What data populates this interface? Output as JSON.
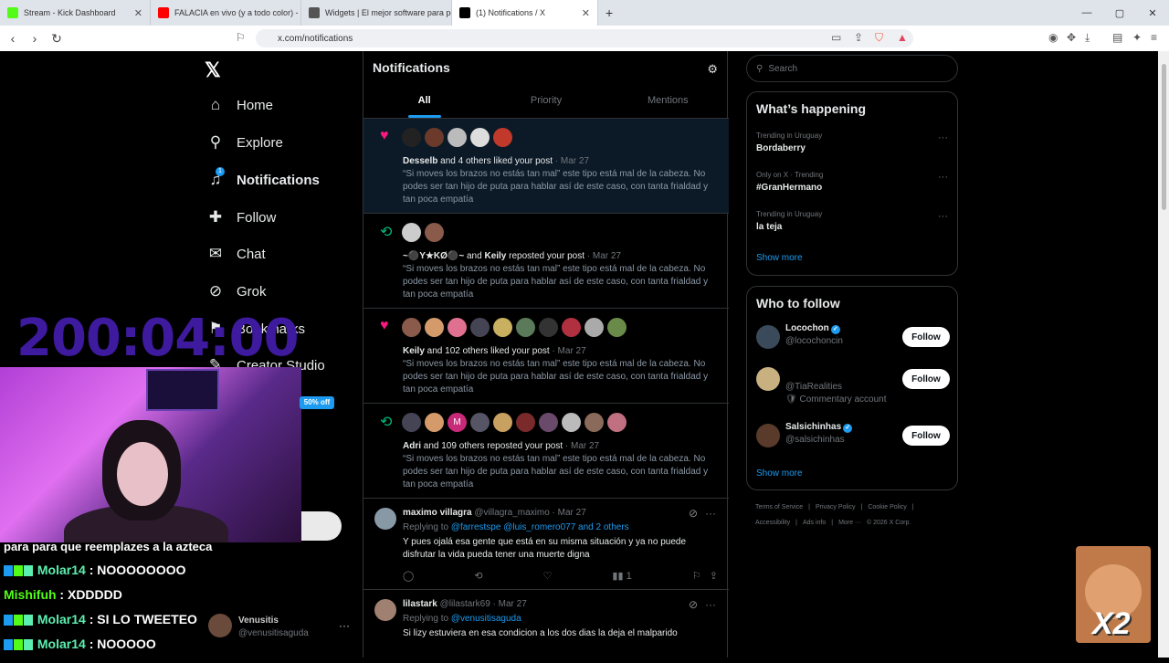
{
  "browser": {
    "tabs": [
      {
        "label": "Stream - Kick Dashboard",
        "color": "#53fc18"
      },
      {
        "label": "FALACIA en vivo (y a todo color) - Rı",
        "color": "#ff0000"
      },
      {
        "label": "Widgets | El mejor software para pot",
        "color": "#333333"
      },
      {
        "label": "(1) Notifications / X",
        "color": "#000000",
        "active": true
      }
    ],
    "new_tab": "+",
    "url": "x.com/notifications",
    "win": [
      "—",
      "▢",
      "✕"
    ]
  },
  "nav": {
    "logo": "𝕏",
    "items": [
      {
        "label": "Home",
        "icon": "home-icon",
        "glyph": "⌂"
      },
      {
        "label": "Explore",
        "icon": "search-icon",
        "glyph": "⚲"
      },
      {
        "label": "Notifications",
        "icon": "bell-icon",
        "glyph": "🔔",
        "bold": true,
        "badge": "1"
      },
      {
        "label": "Follow",
        "icon": "person-plus-icon",
        "glyph": "👤"
      },
      {
        "label": "Chat",
        "icon": "mail-icon",
        "glyph": "✉"
      },
      {
        "label": "Grok",
        "icon": "grok-icon",
        "glyph": "⊘"
      },
      {
        "label": "Bookmarks",
        "icon": "bookmark-icon",
        "glyph": "🔖"
      },
      {
        "label": "Creator Studio",
        "icon": "creator-icon",
        "glyph": "✎"
      }
    ],
    "sale": "50% off"
  },
  "main": {
    "title": "Notifications",
    "tabs": [
      "All",
      "Priority",
      "Mentions"
    ],
    "notifications": [
      {
        "type": "like",
        "who": "Desselb",
        "rest": " and 4 others liked your post",
        "date": " · Mar 27",
        "text": "“Si moves los brazos no estás tan mal” este tipo está mal de la cabeza. No podes ser tan hijo de puta para hablar así de este caso, con tanta frialdad y tan poca empatía"
      },
      {
        "type": "repost",
        "who": "~⚫Y★KØ⚫~",
        "rest": " and ",
        "who2": "Keily",
        "rest2": " reposted your post",
        "date": " · Mar 27",
        "text": "“Si moves los brazos no estás tan mal” este tipo está mal de la cabeza. No podes ser tan hijo de puta para hablar así de este caso, con tanta frialdad y tan poca empatía"
      },
      {
        "type": "like",
        "who": "Keily",
        "rest": " and 102 others liked your post",
        "date": " · Mar 27",
        "text": "“Si moves los brazos no estás tan mal” este tipo está mal de la cabeza. No podes ser tan hijo de puta para hablar así de este caso, con tanta frialdad y tan poca empatía"
      },
      {
        "type": "repost",
        "who": "Adri",
        "rest": " and 109 others reposted your post",
        "date": " · Mar 27",
        "text": "“Si moves los brazos no estás tan mal” este tipo está mal de la cabeza. No podes ser tan hijo de puta para hablar así de este caso, con tanta frialdad y tan poca empatía"
      }
    ],
    "replies": [
      {
        "name": "maximo villagra",
        "handle": " @villagra_maximo · Mar 27",
        "replying": "Replying to ",
        "mentions": "@farrestspe @luis_romero077 and 2 others",
        "body": "Y pues ojalá esa gente que está en su misma situación y ya no puede disfrutar la vida pueda tener una muerte digna",
        "views": "1"
      },
      {
        "name": "lilastark",
        "handle": " @lilastark69 · Mar 27",
        "replying": "Replying to ",
        "mentions": "@venusitisaguda",
        "body": "Si lizy estuviera en esa condicion a los dos dias la deja el malparido",
        "views": ""
      }
    ]
  },
  "right": {
    "search_placeholder": "Search",
    "happening_title": "What’s happening",
    "trends": [
      {
        "meta": "Trending in Uruguay",
        "name": "Bordaberry"
      },
      {
        "meta": "Only on X · Trending",
        "name": "#GranHermano"
      },
      {
        "meta": "Trending in Uruguay",
        "name": "la teja"
      }
    ],
    "show_more": "Show more",
    "wtf_title": "Who to follow",
    "follow": [
      {
        "name": "Locochon",
        "handle": "@locochoncin",
        "verified": true
      },
      {
        "name": "",
        "handle": "@TiaRealities",
        "caption": "🛡 Commentary account",
        "verified": false
      },
      {
        "name": "Salsichinhas",
        "handle": "@salsichinhas",
        "verified": true
      }
    ],
    "follow_label": "Follow",
    "footer": [
      "Terms of Service",
      "|",
      "Privacy Policy",
      "|",
      "Cookie Policy",
      "|"
    ],
    "footer2": [
      "Accessibility",
      "|",
      "Ads info",
      "|",
      "More ···",
      "© 2026 X Corp."
    ]
  },
  "overlay": {
    "timer": "200:04:00",
    "chat": [
      {
        "user": "",
        "msg": "para para que reemplazes a la azteca"
      },
      {
        "user": "Molar14",
        "msg": " : NOOOOOOOO",
        "badges": true
      },
      {
        "user": "Mishifuh",
        "msg": " : XDDDDD"
      },
      {
        "user": "Molar14",
        "msg": " : SI LO TWEETEO",
        "badges": true
      },
      {
        "user": "Molar14",
        "msg": " : NOOOOO",
        "badges": true
      }
    ],
    "account": {
      "name": "Venusitis",
      "handle": "@venusitisaguda"
    },
    "emote": "X2"
  }
}
